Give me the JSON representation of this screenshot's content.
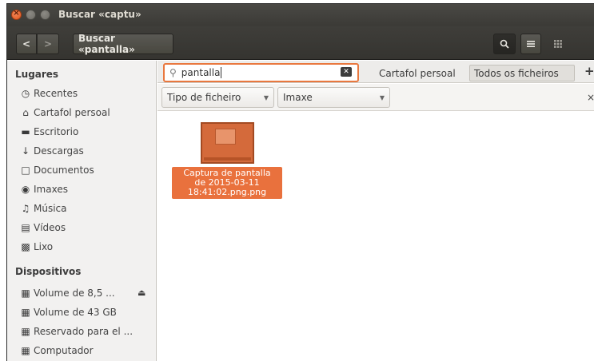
{
  "window": {
    "title": "Buscar «captu»"
  },
  "header": {
    "back": "<",
    "forward": ">",
    "path": "Buscar «pantalla»",
    "search_icon": "search-icon",
    "menu_icon": "hamburger-icon",
    "view_icon": "grid-icon"
  },
  "sidebar": {
    "places_title": "Lugares",
    "places": [
      {
        "label": "Recentes",
        "icon": "clock-icon"
      },
      {
        "label": "Cartafol persoal",
        "icon": "home-icon"
      },
      {
        "label": "Escritorio",
        "icon": "desktop-folder-icon"
      },
      {
        "label": "Descargas",
        "icon": "download-icon"
      },
      {
        "label": "Documentos",
        "icon": "document-icon"
      },
      {
        "label": "Imaxes",
        "icon": "camera-icon"
      },
      {
        "label": "Música",
        "icon": "music-icon"
      },
      {
        "label": "Vídeos",
        "icon": "film-icon"
      },
      {
        "label": "Lixo",
        "icon": "trash-icon"
      }
    ],
    "devices_title": "Dispositivos",
    "devices": [
      {
        "label": "Volume de 8,5 ...",
        "icon": "drive-icon",
        "eject": true
      },
      {
        "label": "Volume de 43 GB",
        "icon": "drive-icon"
      },
      {
        "label": "Reservado para el ...",
        "icon": "drive-icon"
      },
      {
        "label": "Computador",
        "icon": "drive-icon"
      }
    ]
  },
  "search": {
    "value": "pantalla",
    "location_home": "Cartafol persoal",
    "location_all": "Todos os ficheiros",
    "add": "+"
  },
  "filter": {
    "type_label": "Tipo de ficheiro",
    "value_label": "Imaxe",
    "remove": "×"
  },
  "files": [
    {
      "name_lines": [
        "Captura de pantalla",
        "de 2015-03-11",
        "18:41:02.png.png"
      ],
      "selected": true
    }
  ],
  "colors": {
    "accent": "#e9713d",
    "titlebar": "#3b3a36",
    "sidebar": "#f2f1f0"
  }
}
